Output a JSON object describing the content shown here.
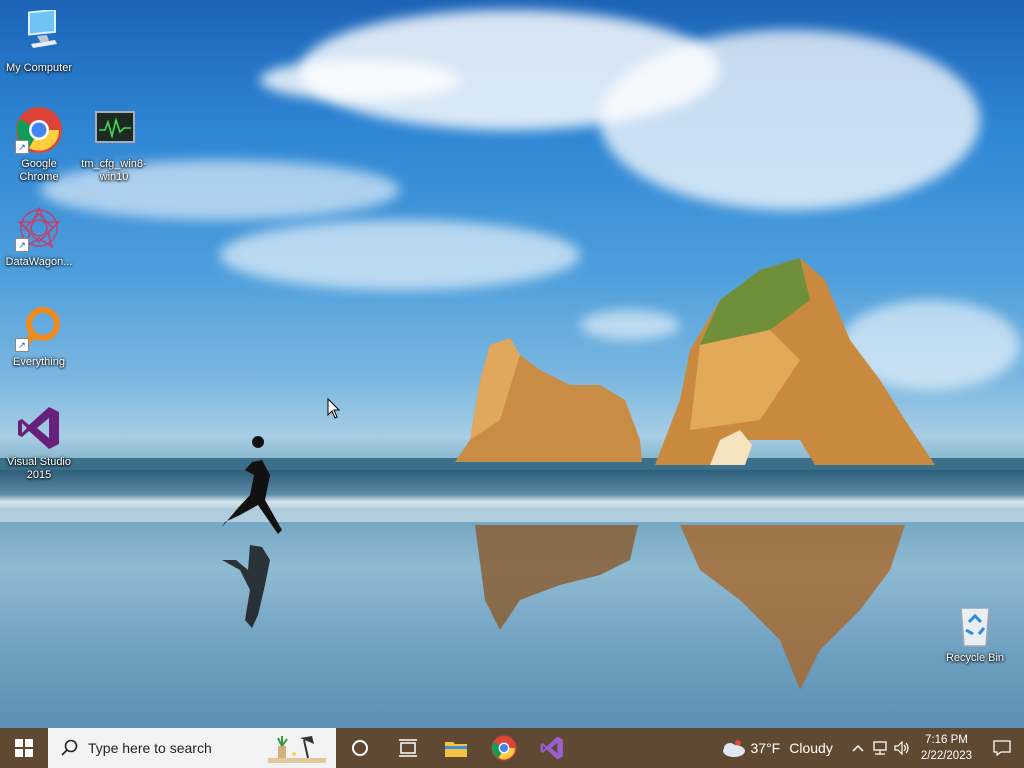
{
  "desktop": {
    "icons": [
      {
        "name": "My Computer",
        "kind": "computer"
      },
      {
        "name": "Google Chrome",
        "kind": "chrome",
        "label_line1": "Google",
        "label_line2": "Chrome"
      },
      {
        "name": "tm_cfg_win8-win10",
        "kind": "monitor",
        "label_line1": "tm_cfg_win8-",
        "label_line2": "win10"
      },
      {
        "name": "DataWagon...",
        "kind": "datawagon"
      },
      {
        "name": "Everything",
        "kind": "everything"
      },
      {
        "name": "Visual Studio 2015",
        "kind": "visual-studio",
        "label_line1": "Visual Studio",
        "label_line2": "2015"
      },
      {
        "name": "Recycle Bin",
        "kind": "recycle-bin"
      }
    ]
  },
  "taskbar": {
    "search_placeholder": "Type here to search",
    "pinned": [
      "start-icon",
      "cortana-icon",
      "task-view-icon",
      "file-explorer-icon",
      "chrome-icon",
      "visual-studio-icon"
    ],
    "weather": {
      "temp": "37°F",
      "condition": "Cloudy"
    },
    "clock": {
      "time": "7:16 PM",
      "date": "2/22/2023"
    }
  },
  "colors": {
    "taskbar": "#52392a",
    "search_bg": "#f3f3f3",
    "vs_purple": "#68217a"
  }
}
